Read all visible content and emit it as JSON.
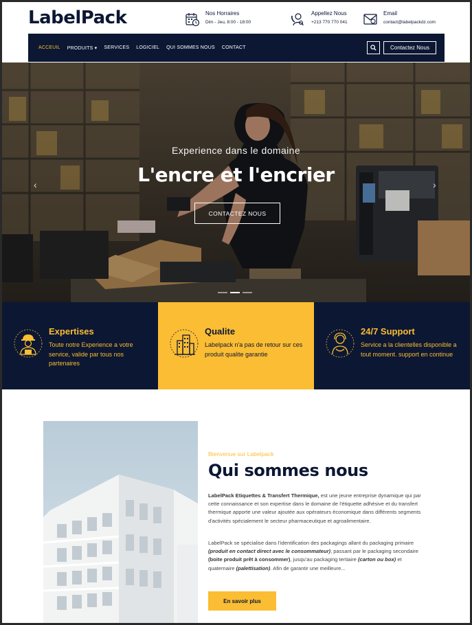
{
  "header": {
    "logo": "LabelPack",
    "hours": {
      "title": "Nos Horraires",
      "value": "Dim - Jeu, 8:00 - 18:00"
    },
    "phone": {
      "title": "Appellez Nous",
      "value": "+213 770 770 041"
    },
    "email": {
      "title": "Email",
      "value": "contact@labelpackdz.com"
    }
  },
  "nav": {
    "items": [
      {
        "label": "ACCEUIL",
        "active": true
      },
      {
        "label": "PRODUITS ▾",
        "active": false
      },
      {
        "label": "SERVICES",
        "active": false
      },
      {
        "label": "LOGICIEL",
        "active": false
      },
      {
        "label": "QUI SOMMES NOUS",
        "active": false
      },
      {
        "label": "CONTACT",
        "active": false
      }
    ],
    "contact_button": "Contactez Nous"
  },
  "hero": {
    "subtitle": "Experience dans le domaine",
    "title": "L'encre et l'encrier",
    "button": "CONTACTEZ NOUS",
    "slides": 3,
    "active_slide": 2
  },
  "features": [
    {
      "title": "Expertises",
      "text": "Toute notre Experience a votre service, valide par tous nos partenaires",
      "icon": "worker-icon"
    },
    {
      "title": "Qualite",
      "text": "Labelpack n'a pas de retour sur ces produit qualite garantie",
      "icon": "buildings-icon"
    },
    {
      "title": "24/7 Support",
      "text": "Service a la clientelles disponible a tout moment. support en continue",
      "icon": "support-agent-icon"
    }
  ],
  "about": {
    "kicker": "Bienvenue sur Labelpack",
    "title": "Qui sommes nous",
    "p1_bold": "LabelPack Etiquettes & Transfert Thermique,",
    "p1_rest": " est une jeune entreprise dynamique qui par cette connaissance et son expertise dans le domaine de l'étiquette adhésive et du transfert thermique apporte une valeur ajoutée aux opérateurs économique dans différents segments d'activités spécialement le secteur pharmaceutique et agroalimentaire.",
    "p2_a": "LabelPack se spécialise dans l'identification des packagings allant du packaging primaire ",
    "p2_b": "(produit en contact direct avec le consommateur)",
    "p2_c": ", passant par le packaging secondaire ",
    "p2_d": "(boite produit prêt à consommer)",
    "p2_e": ", jusqu'au packaging tertiaire ",
    "p2_f": "(carton ou box)",
    "p2_g": " et quaternaire ",
    "p2_h": "(palettisation)",
    "p2_i": ". Afin de garantir une meilleure...",
    "button": "En savoir plus"
  },
  "colors": {
    "navy": "#0c1733",
    "yellow": "#fbbd33",
    "white": "#ffffff"
  }
}
